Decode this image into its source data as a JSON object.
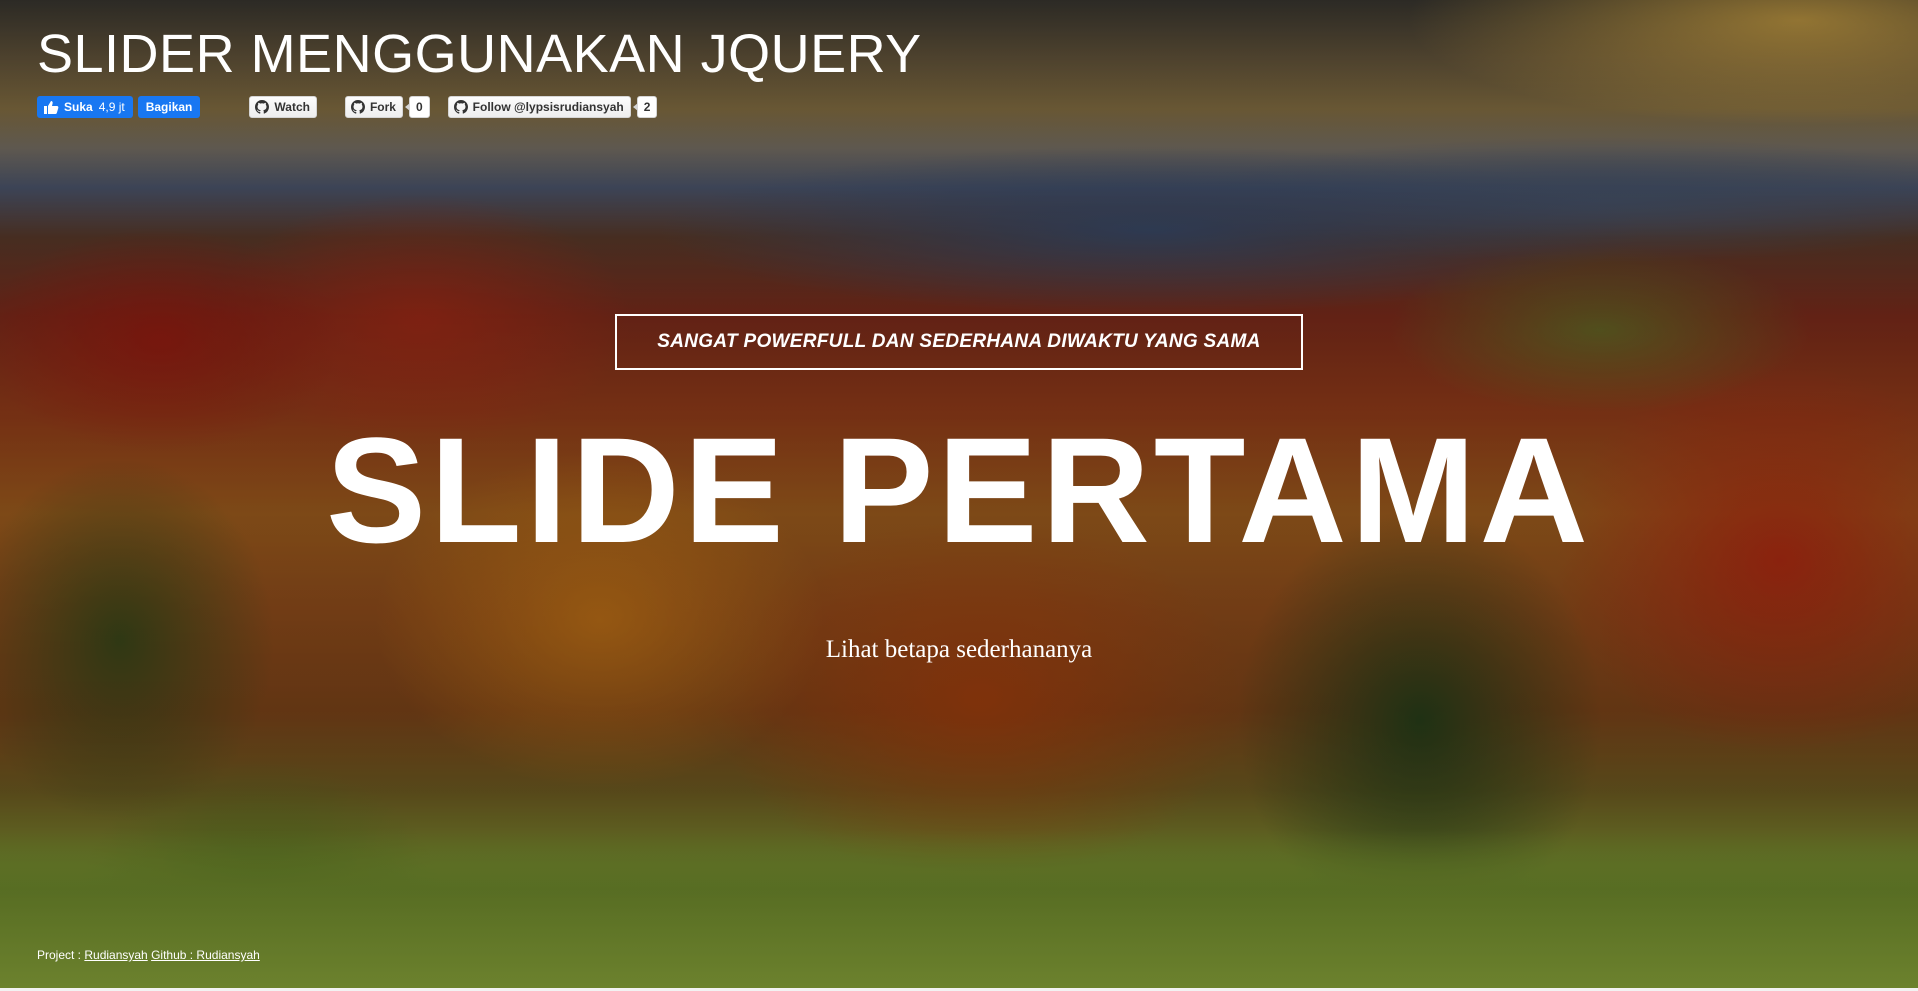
{
  "header": {
    "title": "SLIDER MENGGUNAKAN JQUERY"
  },
  "social": {
    "facebook": {
      "like_label": "Suka",
      "like_count": "4,9 jt",
      "share_label": "Bagikan"
    },
    "github": {
      "watch_label": "Watch",
      "fork_label": "Fork",
      "fork_count": "0",
      "follow_label": "Follow @lypsisrudiansyah",
      "follow_count": "2"
    }
  },
  "slide": {
    "tagline": "SANGAT POWERFULL DAN SEDERHANA DIWAKTU YANG SAMA",
    "title": "SLIDE PERTAMA",
    "subtitle": "Lihat betapa sederhananya"
  },
  "footer": {
    "project_prefix": "Project : ",
    "project_link": "Rudiansyah",
    "github_link": "Github : Rudiansyah"
  },
  "colors": {
    "facebook_blue": "#1877f2",
    "text": "#ffffff"
  },
  "icons": {
    "like": "thumbs-up-icon",
    "github": "github-icon"
  }
}
